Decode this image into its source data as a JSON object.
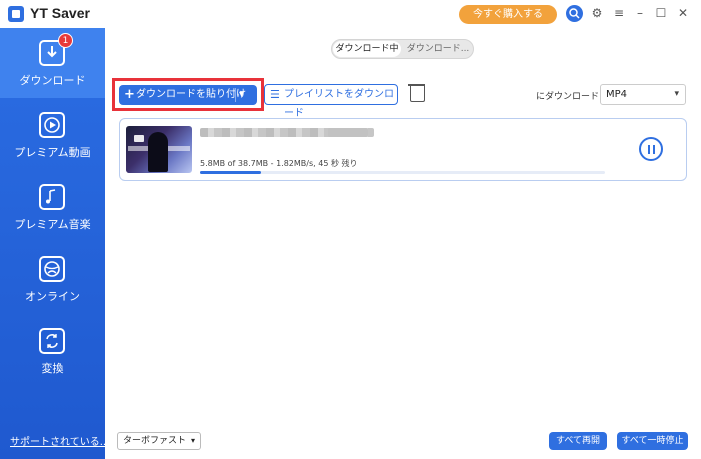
{
  "app": {
    "title": "YT Saver"
  },
  "titlebar": {
    "buy_label": "今すぐ購入する"
  },
  "sidebar": {
    "items": [
      {
        "label": "ダウンロード",
        "icon": "download-icon",
        "badge": "1"
      },
      {
        "label": "プレミアム動画",
        "icon": "play-icon"
      },
      {
        "label": "プレミアム音楽",
        "icon": "music-icon"
      },
      {
        "label": "オンライン",
        "icon": "globe-icon"
      },
      {
        "label": "変換",
        "icon": "convert-icon"
      }
    ],
    "support_label": "サポートされている..."
  },
  "tabs": {
    "downloading": "ダウンロード中",
    "downloaded": "ダウンロード..."
  },
  "toolbar": {
    "paste_label": "ダウンロードを貼り付け",
    "playlist_label": "プレイリストをダウンロード",
    "download_as_label": "にダウンロード",
    "format": "MP4"
  },
  "download_item": {
    "progress_text": "5.8MB of 38.7MB -   1.82MB/s, 45 秒 残り",
    "progress": 0.15
  },
  "bottom": {
    "turbo_label": "ターボファスト",
    "resume_all_label": "すべて再開",
    "pause_all_label": "すべて一時停止"
  },
  "colors": {
    "accent": "#2f6fe0",
    "highlight": "#e8323a",
    "buy": "#f2a23c"
  }
}
